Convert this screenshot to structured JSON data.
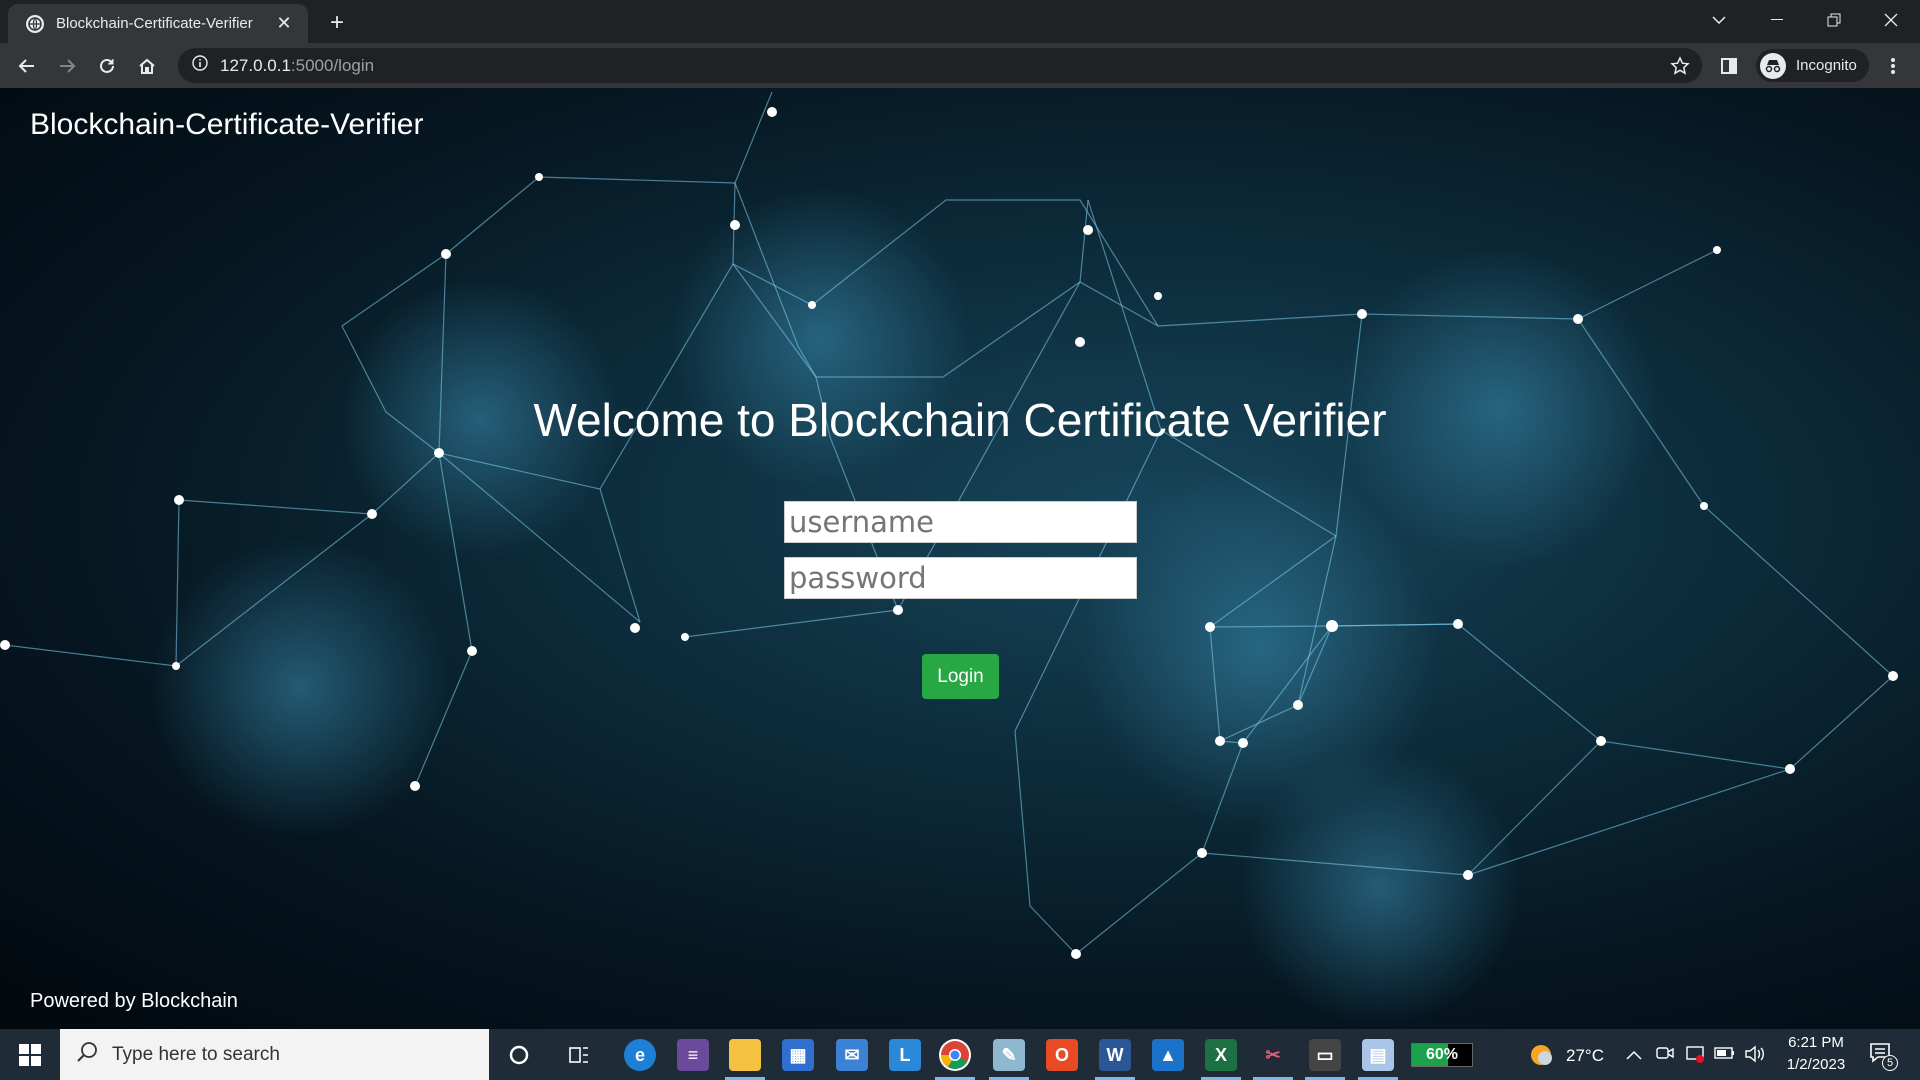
{
  "browser": {
    "tab_title": "Blockchain-Certificate-Verifier",
    "url_host": "127.0.0.1",
    "url_path": ":5000/login",
    "profile_label": "Incognito"
  },
  "page": {
    "brand": "Blockchain-Certificate-Verifier",
    "welcome": "Welcome to Blockchain Certificate Verifier",
    "username_placeholder": "username",
    "password_placeholder": "password",
    "login_label": "Login",
    "footer": "Powered by Blockchain"
  },
  "taskbar": {
    "search_placeholder": "Type here to search",
    "battery": "60%",
    "temperature": "27°C",
    "time": "6:21 PM",
    "date": "1/2/2023",
    "notification_count": "5"
  },
  "colors": {
    "login_button": "#28a745",
    "chrome_dark": "#202124",
    "chrome_mid": "#35363a"
  }
}
